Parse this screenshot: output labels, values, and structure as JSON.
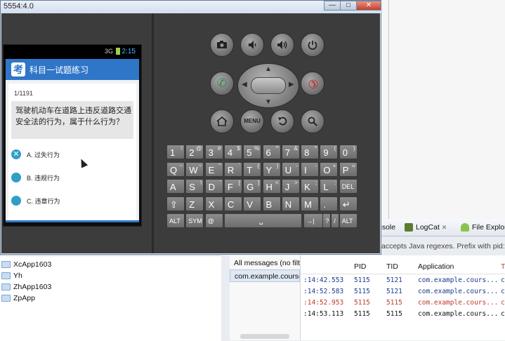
{
  "emulator": {
    "title": "5554:4.0",
    "window_controls": {
      "minimize": "—",
      "maximize": "□",
      "close": "✕"
    }
  },
  "phone": {
    "status_signal": "3G",
    "status_time": "2:15",
    "app_icon_glyph": "考",
    "app_title": "科目一试题练习",
    "question_counter": "1/1191",
    "question_text": "驾驶机动车在道路上违反道路交通安全法的行为，属于什么行为？",
    "options": [
      {
        "label": "A. 过失行为",
        "selected": true
      },
      {
        "label": "B. 违规行为",
        "selected": false
      },
      {
        "label": "C. 违章行为",
        "selected": false
      }
    ],
    "accent_color": "#2f76c8",
    "option_color": "#2e9fc6"
  },
  "hardware_buttons": {
    "camera": "camera-icon",
    "volume_down": "volume-down-icon",
    "volume_up": "volume-up-icon",
    "power": "power-icon",
    "call": "call-icon",
    "end_call": "end-call-icon",
    "home": "home-icon",
    "menu": "MENU",
    "back": "back-icon",
    "search": "search-icon"
  },
  "keyboard": {
    "row1": [
      [
        "1",
        "!"
      ],
      [
        "2",
        "@"
      ],
      [
        "3",
        "#"
      ],
      [
        "4",
        "$"
      ],
      [
        "5",
        "%"
      ],
      [
        "6",
        "^"
      ],
      [
        "7",
        "&"
      ],
      [
        "8",
        "*"
      ],
      [
        "9",
        "("
      ],
      [
        "0",
        ")"
      ]
    ],
    "row2": [
      [
        "Q",
        "~"
      ],
      [
        "W",
        "~"
      ],
      [
        "E",
        "\""
      ],
      [
        "R",
        "`"
      ],
      [
        "T",
        "{"
      ],
      [
        "Y",
        "}"
      ],
      [
        "U",
        "-"
      ],
      [
        "I",
        "-"
      ],
      [
        "O",
        "+"
      ],
      [
        "P",
        "="
      ]
    ],
    "row3": [
      [
        "A",
        ""
      ],
      [
        "S",
        "\\"
      ],
      [
        "D",
        "'"
      ],
      [
        "F",
        "["
      ],
      [
        "G",
        "]"
      ],
      [
        "H",
        "<"
      ],
      [
        "J",
        ">"
      ],
      [
        "K",
        ";"
      ],
      [
        "L",
        ":"
      ],
      [
        "DEL",
        ""
      ]
    ],
    "row4": [
      [
        "⇧",
        ""
      ],
      [
        "Z",
        ""
      ],
      [
        "X",
        ""
      ],
      [
        "C",
        ""
      ],
      [
        "V",
        ""
      ],
      [
        "B",
        ""
      ],
      [
        "N",
        ""
      ],
      [
        "M",
        ""
      ],
      [
        ".",
        ""
      ],
      [
        "↵",
        ""
      ]
    ],
    "row5": {
      "alt_left": "ALT",
      "sym": "SYM",
      "at": "@",
      "space": "␣",
      "arrow": "→|",
      "qmark": "?",
      "slash": "/",
      "comma": ",",
      "alt_right": "ALT"
    }
  },
  "ide": {
    "tabs": {
      "console": "nsole",
      "logcat": "LogCat",
      "explorer": "File Explor"
    },
    "hint": "accepts Java regexes. Prefix with pid:, a",
    "projects": [
      "XcApp1603",
      "Yh",
      "ZhApp1603",
      "ZpApp"
    ],
    "filters": [
      "All messages (no filte",
      "com.example.course"
    ],
    "log_headers": {
      "pid": "PID",
      "tid": "TID",
      "application": "Application",
      "tag": "T"
    },
    "log_rows": [
      {
        "time": ":14:42.553",
        "pid": "5115",
        "tid": "5121",
        "app": "com.example.cours...",
        "tag": "c",
        "color": "#1a3b8f"
      },
      {
        "time": ":14:52.583",
        "pid": "5115",
        "tid": "5121",
        "app": "com.example.cours...",
        "tag": "c",
        "color": "#1a3b8f"
      },
      {
        "time": ":14:52.953",
        "pid": "5115",
        "tid": "5115",
        "app": "com.example.cours...",
        "tag": "c",
        "color": "#c0392b"
      },
      {
        "time": ":14:53.113",
        "pid": "5115",
        "tid": "5115",
        "app": "com.example.cours...",
        "tag": "c",
        "color": "#111111"
      }
    ]
  }
}
